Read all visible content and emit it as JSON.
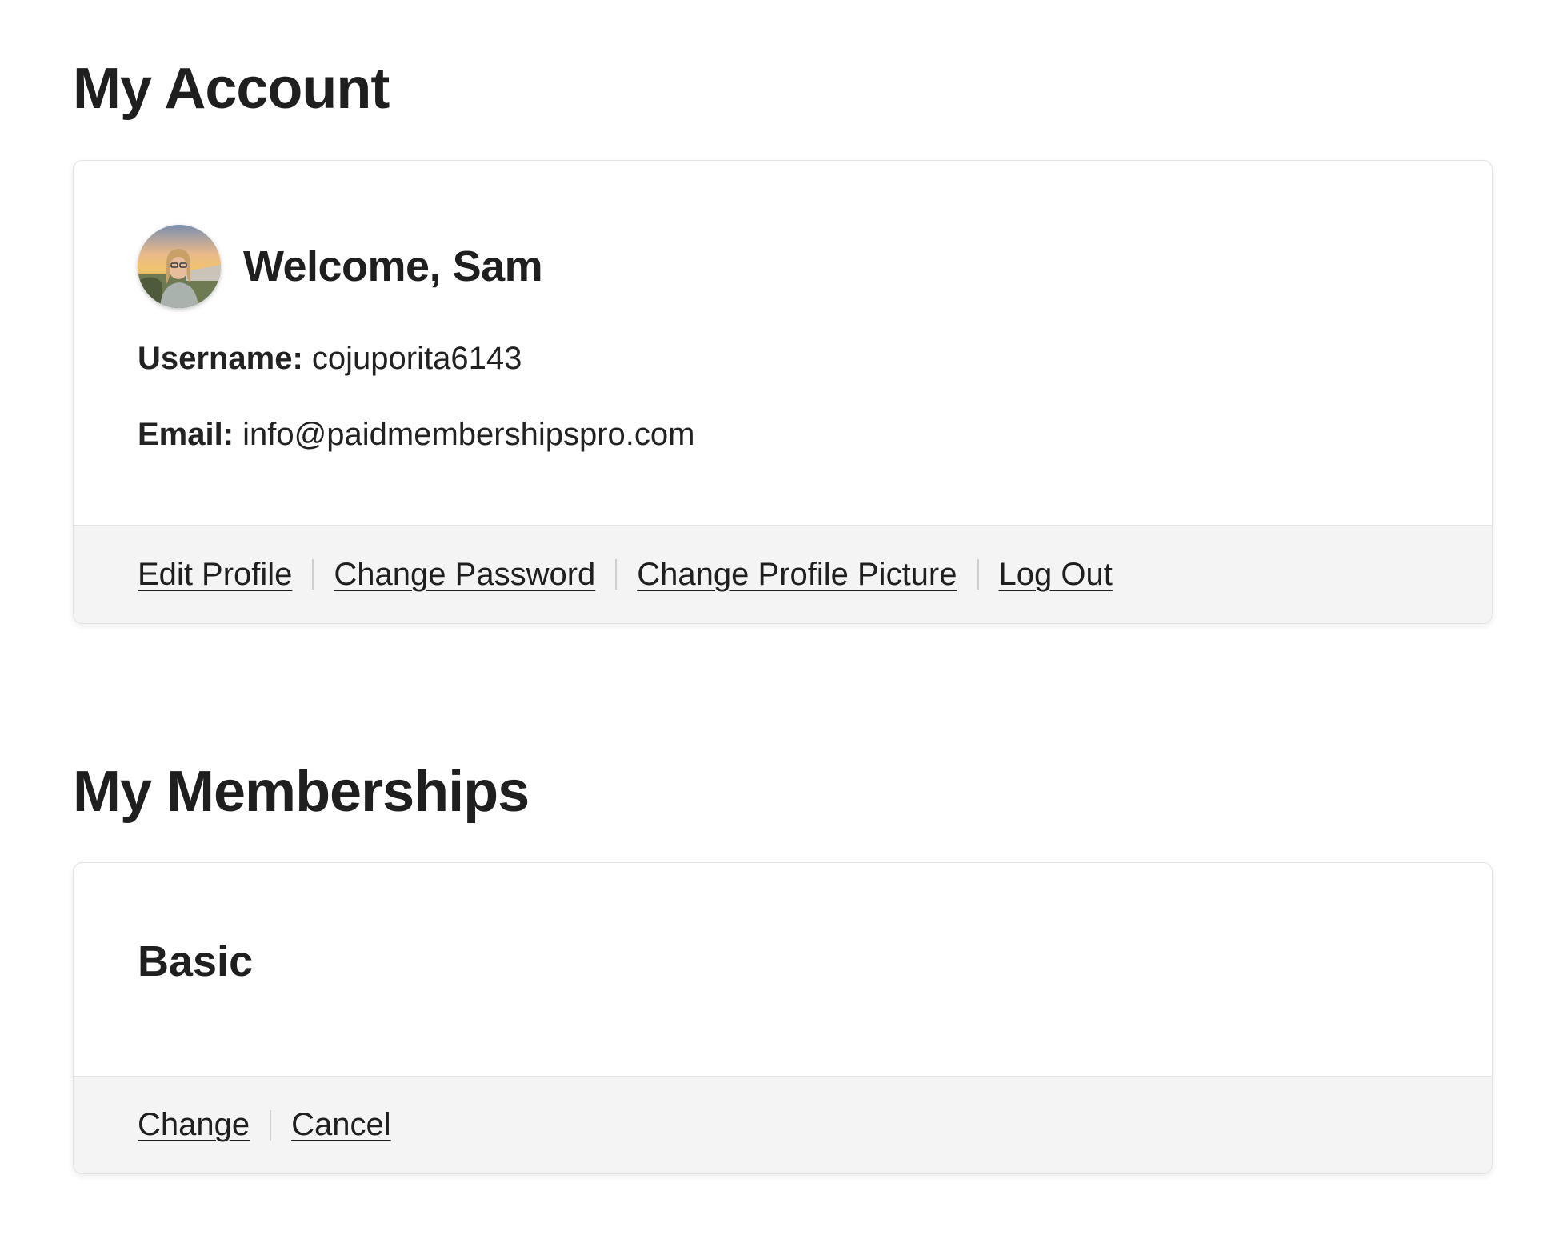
{
  "account": {
    "title": "My Account",
    "welcome": "Welcome, Sam",
    "username_label": "Username:",
    "username_value": "cojuporita6143",
    "email_label": "Email:",
    "email_value": "info@paidmembershipspro.com",
    "avatar_icon": "user-avatar-photo",
    "links": {
      "edit_profile": "Edit Profile",
      "change_password": "Change Password",
      "change_profile_picture": "Change Profile Picture",
      "log_out": "Log Out"
    }
  },
  "memberships": {
    "title": "My Memberships",
    "level_name": "Basic",
    "links": {
      "change": "Change",
      "cancel": "Cancel"
    }
  },
  "colors": {
    "text": "#1f1f1f",
    "footer_bg": "#f4f4f4",
    "card_border": "#e3e3e3",
    "separator": "#cfcfcf"
  }
}
